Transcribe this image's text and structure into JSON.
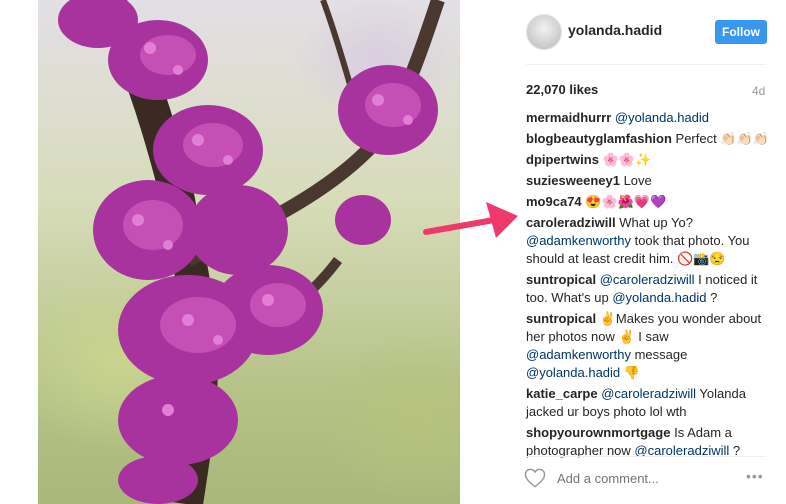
{
  "post": {
    "username": "yolanda.hadid",
    "follow_label": "Follow",
    "likes": "22,070 likes",
    "age": "4d"
  },
  "comments": [
    {
      "user": "mermaidhurrr",
      "parts": [
        {
          "t": "@yolanda.hadid",
          "m": true
        }
      ]
    },
    {
      "user": "blogbeautyglamfashion",
      "parts": [
        {
          "t": "Perfect 👏🏻👏🏻👏🏻",
          "m": false
        }
      ]
    },
    {
      "user": "dpipertwins",
      "parts": [
        {
          "t": "🌸🌸✨",
          "m": false
        }
      ]
    },
    {
      "user": "suziesweeney1",
      "parts": [
        {
          "t": "Love",
          "m": false
        }
      ]
    },
    {
      "user": "mo9ca74",
      "parts": [
        {
          "t": "😍🌸🌺💗💜",
          "m": false
        }
      ]
    },
    {
      "user": "caroleradziwill",
      "parts": [
        {
          "t": "What up Yo? ",
          "m": false
        },
        {
          "t": "@adamkenworthy",
          "m": true
        },
        {
          "t": " took that photo. You should at least credit him. 🚫📸😒",
          "m": false
        }
      ]
    },
    {
      "user": "suntropical",
      "parts": [
        {
          "t": "@caroleradziwill",
          "m": true
        },
        {
          "t": " I noticed it too. What's up ",
          "m": false
        },
        {
          "t": "@yolanda.hadid",
          "m": true
        },
        {
          "t": " ?",
          "m": false
        }
      ]
    },
    {
      "user": "suntropical",
      "parts": [
        {
          "t": "✌️Makes you wonder about her photos now ✌️ I saw ",
          "m": false
        },
        {
          "t": "@adamkenworthy",
          "m": true
        },
        {
          "t": " message ",
          "m": false
        },
        {
          "t": "@yolanda.hadid",
          "m": true
        },
        {
          "t": " 👎",
          "m": false
        }
      ]
    },
    {
      "user": "katie_carpe",
      "parts": [
        {
          "t": "@caroleradziwill",
          "m": true
        },
        {
          "t": " Yolanda jacked ur boys photo lol wth",
          "m": false
        }
      ]
    },
    {
      "user": "shopyourownmortgage",
      "parts": [
        {
          "t": "Is Adam a photographer now ",
          "m": false
        },
        {
          "t": "@caroleradziwill",
          "m": true
        },
        {
          "t": " ?",
          "m": false
        }
      ]
    }
  ],
  "footer": {
    "add_comment_placeholder": "Add a comment...",
    "more_label": "•••"
  },
  "colors": {
    "follow_button": "#3897f0",
    "mention": "#003569",
    "arrow": "#f0396b",
    "flowers": "#a8339e"
  },
  "icons": [
    "heart-icon",
    "more-options-icon",
    "annotation-arrow-icon"
  ]
}
